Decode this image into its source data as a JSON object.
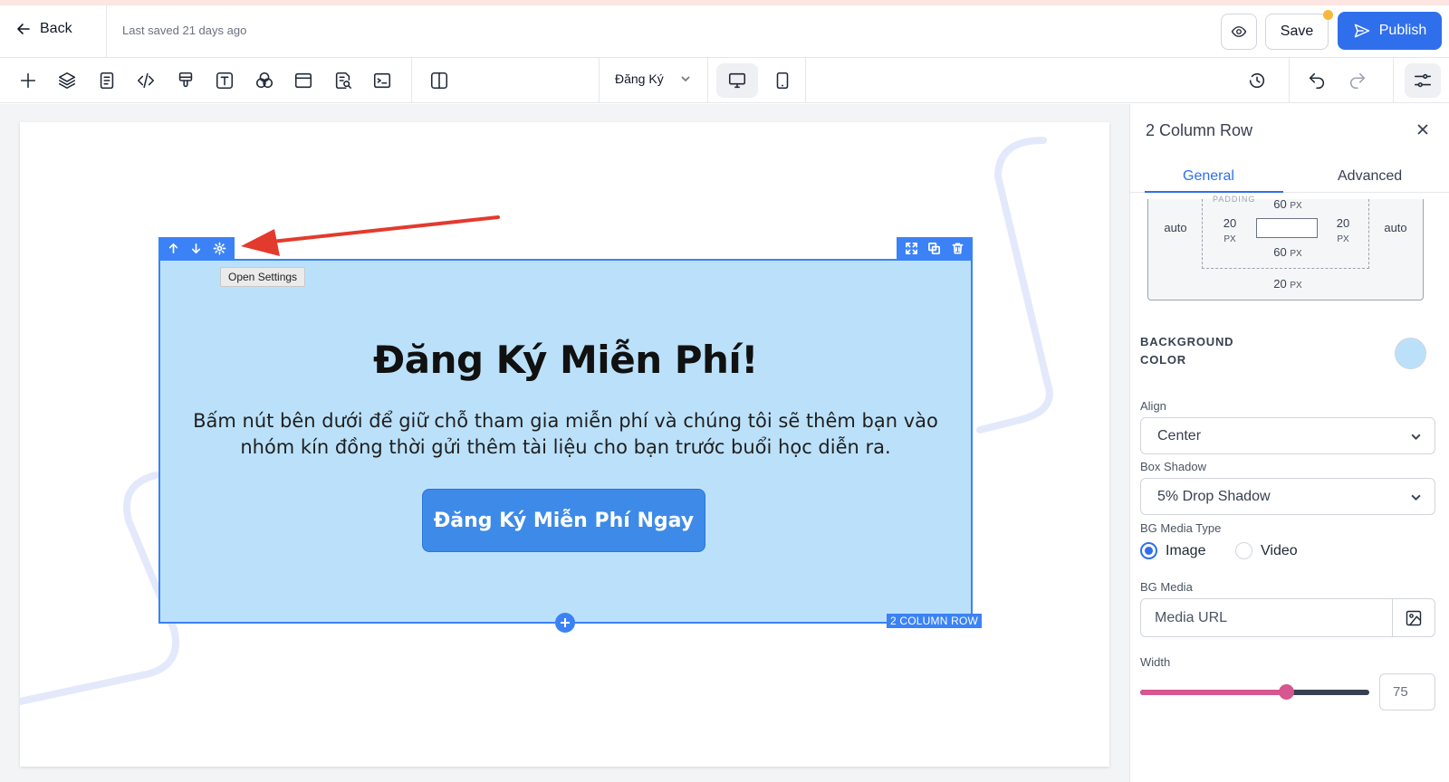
{
  "header": {
    "back_label": "Back",
    "last_saved": "Last saved 21 days ago",
    "save_label": "Save",
    "publish_label": "Publish"
  },
  "toolbar": {
    "tools": [
      "add-icon",
      "layers-icon",
      "page-icon",
      "code-icon",
      "brush-icon",
      "text-icon",
      "color-icon",
      "window-icon",
      "search-doc-icon",
      "terminal-icon",
      "columns-icon"
    ],
    "page_selected": "Đăng Ký",
    "devices": [
      "desktop",
      "tablet"
    ]
  },
  "canvas": {
    "tooltip": "Open Settings",
    "row_badge": "2 COLUMN ROW",
    "title": "Đăng Ký Miễn Phí!",
    "description": "Bấm nút bên dưới để giữ chỗ tham gia miễn phí và chúng tôi sẽ thêm bạn vào nhóm kín đồng thời gửi thêm tài liệu cho bạn trước buổi học diễn ra.",
    "cta": "Đăng Ký Miễn Phí Ngay"
  },
  "panel": {
    "title": "2 Column Row",
    "tabs": [
      "General",
      "Advanced"
    ],
    "spacing": {
      "padding_label": "PADDING",
      "margin_left": "auto",
      "margin_right": "auto",
      "margin_bottom": "20",
      "padding_top": "60",
      "padding_bottom": "60",
      "padding_left": "20",
      "padding_right": "20",
      "unit": "PX"
    },
    "background_color_label_1": "BACKGROUND",
    "background_color_label_2": "COLOR",
    "background_color": "#bbe1fa",
    "align_label": "Align",
    "align_value": "Center",
    "box_shadow_label": "Box Shadow",
    "box_shadow_value": "5% Drop Shadow",
    "bg_media_type_label": "BG Media Type",
    "bg_media_type_options": [
      "Image",
      "Video"
    ],
    "bg_media_type_selected": "Image",
    "bg_media_label": "BG Media",
    "bg_media_placeholder": "Media URL",
    "width_label": "Width",
    "width_value": "75"
  },
  "colors": {
    "accent": "#2f6fec",
    "row_bg": "#bbe1fa",
    "selection": "#3b82f6",
    "cta": "#3d8ae9",
    "slider": "#d6568f",
    "annotation_arrow": "#e23b2e"
  }
}
